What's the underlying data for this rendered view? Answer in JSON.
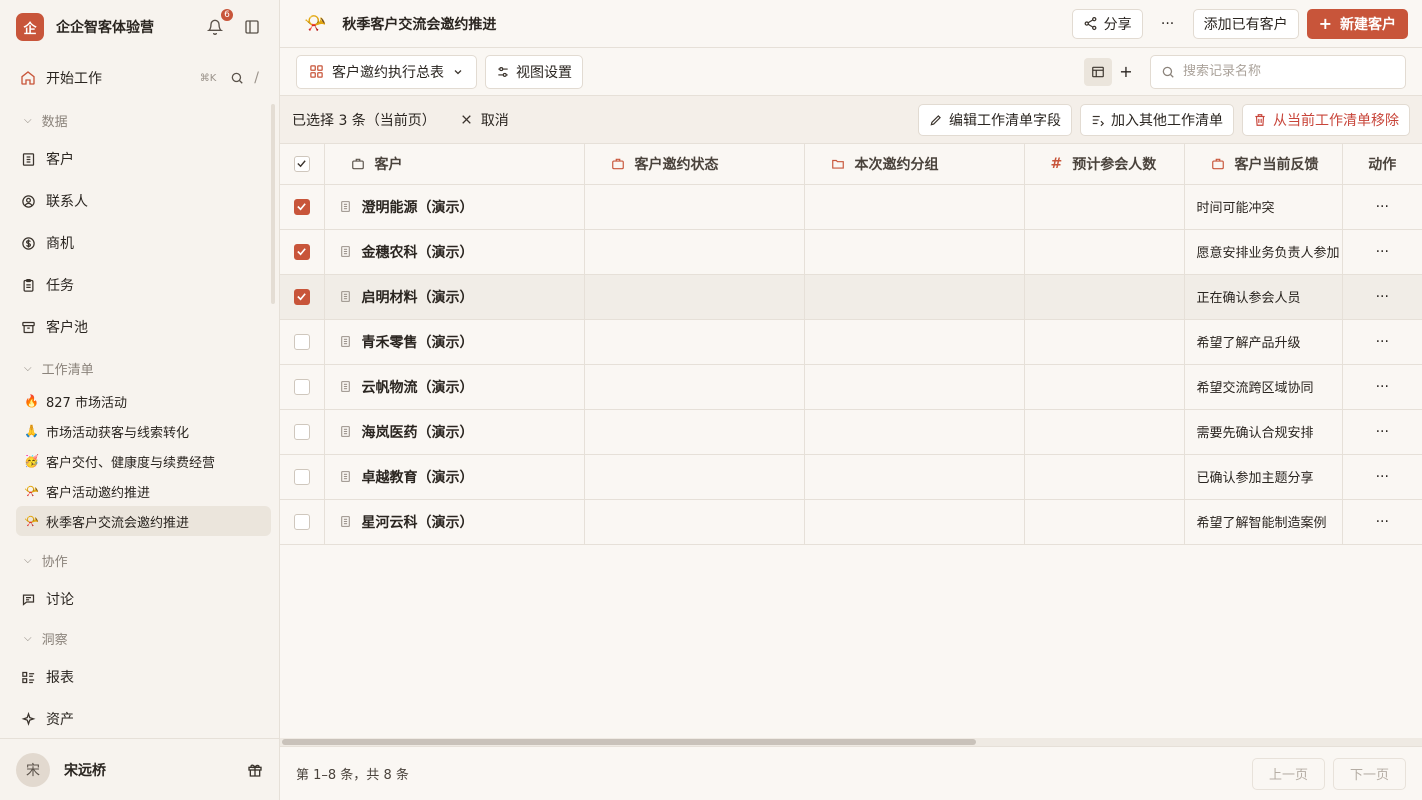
{
  "sidebar": {
    "org_logo": "企",
    "org_name": "企企智客体验营",
    "notification_count": "6",
    "start": {
      "label": "开始工作",
      "shortcut": "⌘K",
      "slash": "/"
    },
    "sections": {
      "data": "数据",
      "worklists": "工作清单",
      "collab": "协作",
      "insight": "洞察"
    },
    "data_items": [
      {
        "label": "客户",
        "icon": "building-icon"
      },
      {
        "label": "联系人",
        "icon": "user-circle-icon"
      },
      {
        "label": "商机",
        "icon": "dollar-icon"
      },
      {
        "label": "任务",
        "icon": "clipboard-icon"
      },
      {
        "label": "客户池",
        "icon": "archive-icon"
      }
    ],
    "worklists": [
      {
        "emoji": "🔥",
        "label": "827 市场活动"
      },
      {
        "emoji": "🙏",
        "label": "市场活动获客与线索转化"
      },
      {
        "emoji": "🥳",
        "label": "客户交付、健康度与续费经营"
      },
      {
        "emoji": "📯",
        "label": "客户活动邀约推进"
      },
      {
        "emoji": "📯",
        "label": "秋季客户交流会邀约推进"
      }
    ],
    "collab_items": [
      {
        "label": "讨论",
        "icon": "chat-icon"
      }
    ],
    "insight_items": [
      {
        "label": "报表",
        "icon": "report-icon"
      },
      {
        "label": "资产",
        "icon": "sparkle-icon"
      }
    ],
    "user": {
      "avatar": "宋",
      "name": "宋远桥"
    }
  },
  "header": {
    "icon": "📯",
    "title": "秋季客户交流会邀约推进",
    "share": "分享",
    "more": "···",
    "add_existing": "添加已有客户",
    "new_customer": "新建客户"
  },
  "toolbar": {
    "view_name": "客户邀约执行总表",
    "view_settings": "视图设置",
    "search_placeholder": "搜索记录名称"
  },
  "selection": {
    "count_text": "已选择 3 条（当前页）",
    "cancel": "取消",
    "edit_fields": "编辑工作清单字段",
    "add_to_other": "加入其他工作清单",
    "remove": "从当前工作清单移除"
  },
  "table": {
    "columns": [
      "客户",
      "客户邀约状态",
      "本次邀约分组",
      "预计参会人数",
      "客户当前反馈",
      "动作"
    ],
    "rows": [
      {
        "checked": true,
        "customer": "澄明能源（演示）",
        "status": "",
        "group": "",
        "count": "",
        "feedback": "时间可能冲突"
      },
      {
        "checked": true,
        "customer": "金穗农科（演示）",
        "status": "",
        "group": "",
        "count": "",
        "feedback": "愿意安排业务负责人参加"
      },
      {
        "checked": true,
        "customer": "启明材料（演示）",
        "status": "",
        "group": "",
        "count": "",
        "feedback": "正在确认参会人员"
      },
      {
        "checked": false,
        "customer": "青禾零售（演示）",
        "status": "",
        "group": "",
        "count": "",
        "feedback": "希望了解产品升级"
      },
      {
        "checked": false,
        "customer": "云帆物流（演示）",
        "status": "",
        "group": "",
        "count": "",
        "feedback": "希望交流跨区域协同"
      },
      {
        "checked": false,
        "customer": "海岚医药（演示）",
        "status": "",
        "group": "",
        "count": "",
        "feedback": "需要先确认合规安排"
      },
      {
        "checked": false,
        "customer": "卓越教育（演示）",
        "status": "",
        "group": "",
        "count": "",
        "feedback": "已确认参加主题分享"
      },
      {
        "checked": false,
        "customer": "星河云科（演示）",
        "status": "",
        "group": "",
        "count": "",
        "feedback": "希望了解智能制造案例"
      }
    ],
    "row_action": "···"
  },
  "footer": {
    "info": "第 1–8 条，共 8 条",
    "prev": "上一页",
    "next": "下一页"
  },
  "colors": {
    "accent": "#c8553a",
    "danger": "#c8453a",
    "bg": "#faf7f3"
  }
}
